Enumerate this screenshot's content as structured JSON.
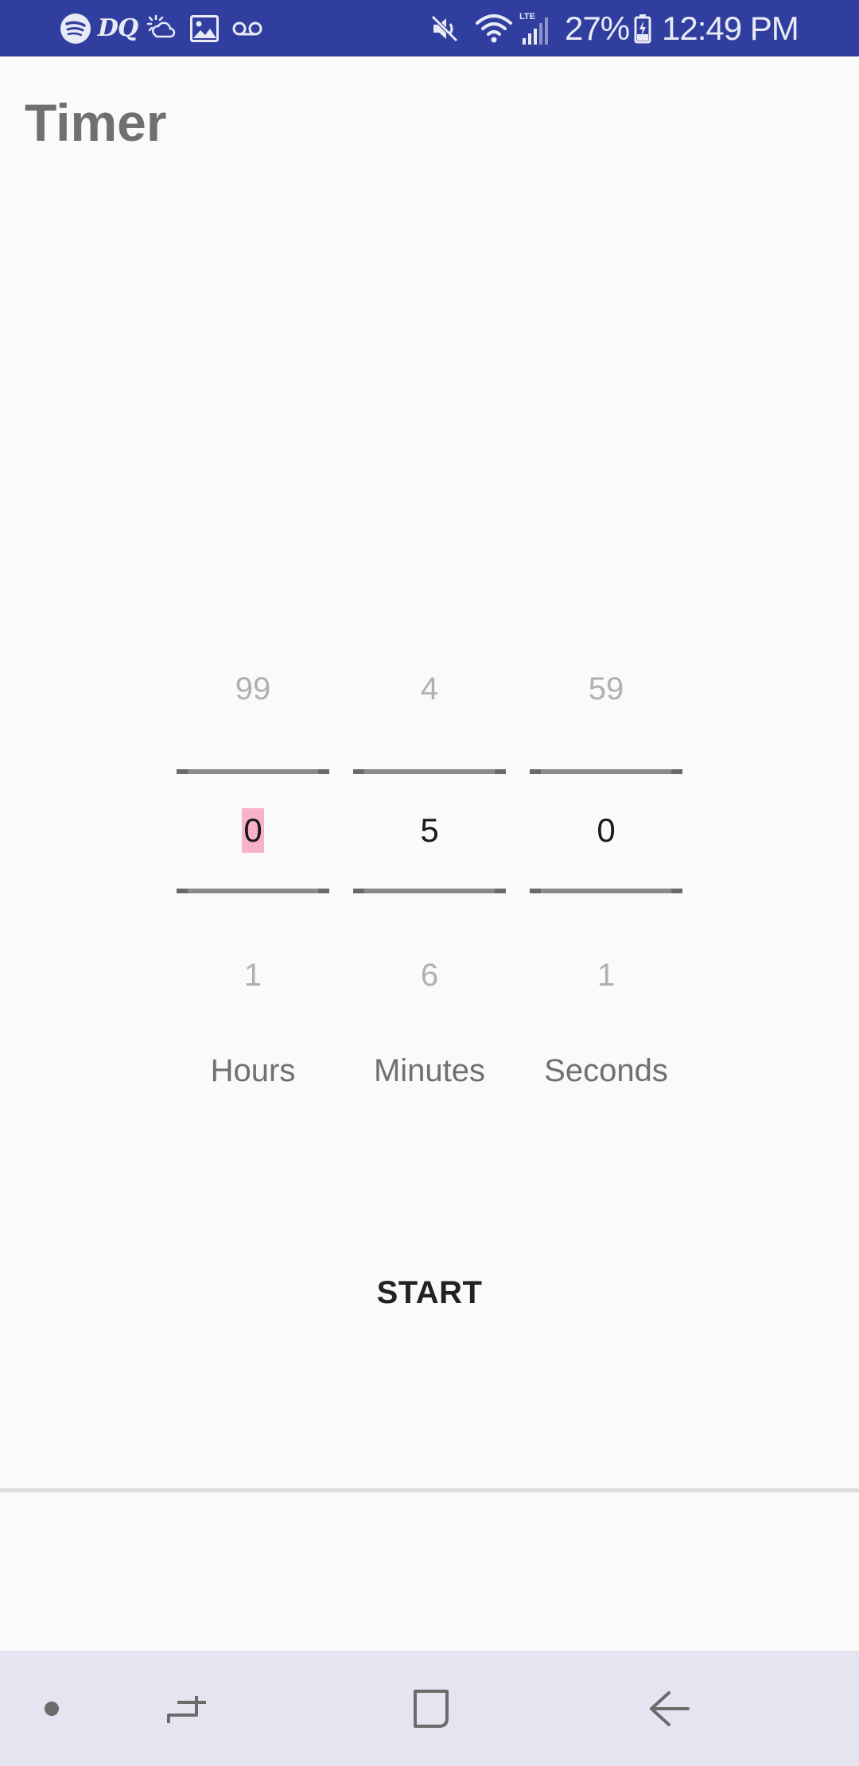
{
  "status_bar": {
    "left_icons": [
      "spotify-icon",
      "dq-icon",
      "weather-icon",
      "image-icon",
      "voicemail-icon"
    ],
    "dq_text": "DQ",
    "right_icons": [
      "mute-icon",
      "wifi-icon",
      "lte-signal-icon",
      "battery-icon"
    ],
    "lte_text": "LTE",
    "battery": "27%",
    "time": "12:49 PM",
    "background_color": "#303f9f"
  },
  "header": {
    "title": "Timer"
  },
  "pickers": [
    {
      "name": "hours",
      "prev": "99",
      "current": "0",
      "next": "1",
      "label": "Hours"
    },
    {
      "name": "minutes",
      "prev": "4",
      "current": "5",
      "next": "6",
      "label": "Minutes"
    },
    {
      "name": "seconds",
      "prev": "59",
      "current": "0",
      "next": "1",
      "label": "Seconds"
    }
  ],
  "start_button": {
    "label": "START"
  },
  "nav_bar": {
    "buttons": [
      "dot-icon",
      "recents-icon",
      "home-icon",
      "back-icon"
    ],
    "background_color": "#e4e5f0"
  }
}
